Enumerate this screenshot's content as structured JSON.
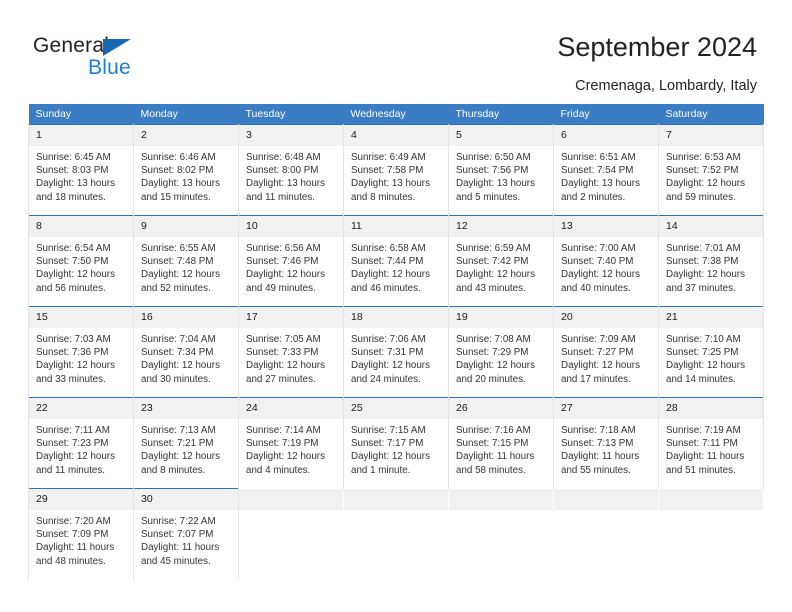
{
  "brand": {
    "name_part1": "General",
    "name_part2": "Blue",
    "triangle_color": "#1668b3",
    "blue_text_color": "#1b7fd4"
  },
  "header": {
    "title": "September 2024",
    "subtitle": "Cremenaga, Lombardy, Italy"
  },
  "theme": {
    "header_bg": "#3b7dc4",
    "row_divider": "#2f6fb5",
    "daynum_bg": "#f1f1f1",
    "cell_border": "#e3e3e3"
  },
  "weekdays": [
    "Sunday",
    "Monday",
    "Tuesday",
    "Wednesday",
    "Thursday",
    "Friday",
    "Saturday"
  ],
  "labels": {
    "sunrise": "Sunrise:",
    "sunset": "Sunset:",
    "daylight": "Daylight:"
  },
  "weeks": [
    [
      {
        "day": "1",
        "sunrise": "Sunrise: 6:45 AM",
        "sunset": "Sunset: 8:03 PM",
        "daylight_line1": "Daylight: 13 hours",
        "daylight_line2": "and 18 minutes."
      },
      {
        "day": "2",
        "sunrise": "Sunrise: 6:46 AM",
        "sunset": "Sunset: 8:02 PM",
        "daylight_line1": "Daylight: 13 hours",
        "daylight_line2": "and 15 minutes."
      },
      {
        "day": "3",
        "sunrise": "Sunrise: 6:48 AM",
        "sunset": "Sunset: 8:00 PM",
        "daylight_line1": "Daylight: 13 hours",
        "daylight_line2": "and 11 minutes."
      },
      {
        "day": "4",
        "sunrise": "Sunrise: 6:49 AM",
        "sunset": "Sunset: 7:58 PM",
        "daylight_line1": "Daylight: 13 hours",
        "daylight_line2": "and 8 minutes."
      },
      {
        "day": "5",
        "sunrise": "Sunrise: 6:50 AM",
        "sunset": "Sunset: 7:56 PM",
        "daylight_line1": "Daylight: 13 hours",
        "daylight_line2": "and 5 minutes."
      },
      {
        "day": "6",
        "sunrise": "Sunrise: 6:51 AM",
        "sunset": "Sunset: 7:54 PM",
        "daylight_line1": "Daylight: 13 hours",
        "daylight_line2": "and 2 minutes."
      },
      {
        "day": "7",
        "sunrise": "Sunrise: 6:53 AM",
        "sunset": "Sunset: 7:52 PM",
        "daylight_line1": "Daylight: 12 hours",
        "daylight_line2": "and 59 minutes."
      }
    ],
    [
      {
        "day": "8",
        "sunrise": "Sunrise: 6:54 AM",
        "sunset": "Sunset: 7:50 PM",
        "daylight_line1": "Daylight: 12 hours",
        "daylight_line2": "and 56 minutes."
      },
      {
        "day": "9",
        "sunrise": "Sunrise: 6:55 AM",
        "sunset": "Sunset: 7:48 PM",
        "daylight_line1": "Daylight: 12 hours",
        "daylight_line2": "and 52 minutes."
      },
      {
        "day": "10",
        "sunrise": "Sunrise: 6:56 AM",
        "sunset": "Sunset: 7:46 PM",
        "daylight_line1": "Daylight: 12 hours",
        "daylight_line2": "and 49 minutes."
      },
      {
        "day": "11",
        "sunrise": "Sunrise: 6:58 AM",
        "sunset": "Sunset: 7:44 PM",
        "daylight_line1": "Daylight: 12 hours",
        "daylight_line2": "and 46 minutes."
      },
      {
        "day": "12",
        "sunrise": "Sunrise: 6:59 AM",
        "sunset": "Sunset: 7:42 PM",
        "daylight_line1": "Daylight: 12 hours",
        "daylight_line2": "and 43 minutes."
      },
      {
        "day": "13",
        "sunrise": "Sunrise: 7:00 AM",
        "sunset": "Sunset: 7:40 PM",
        "daylight_line1": "Daylight: 12 hours",
        "daylight_line2": "and 40 minutes."
      },
      {
        "day": "14",
        "sunrise": "Sunrise: 7:01 AM",
        "sunset": "Sunset: 7:38 PM",
        "daylight_line1": "Daylight: 12 hours",
        "daylight_line2": "and 37 minutes."
      }
    ],
    [
      {
        "day": "15",
        "sunrise": "Sunrise: 7:03 AM",
        "sunset": "Sunset: 7:36 PM",
        "daylight_line1": "Daylight: 12 hours",
        "daylight_line2": "and 33 minutes."
      },
      {
        "day": "16",
        "sunrise": "Sunrise: 7:04 AM",
        "sunset": "Sunset: 7:34 PM",
        "daylight_line1": "Daylight: 12 hours",
        "daylight_line2": "and 30 minutes."
      },
      {
        "day": "17",
        "sunrise": "Sunrise: 7:05 AM",
        "sunset": "Sunset: 7:33 PM",
        "daylight_line1": "Daylight: 12 hours",
        "daylight_line2": "and 27 minutes."
      },
      {
        "day": "18",
        "sunrise": "Sunrise: 7:06 AM",
        "sunset": "Sunset: 7:31 PM",
        "daylight_line1": "Daylight: 12 hours",
        "daylight_line2": "and 24 minutes."
      },
      {
        "day": "19",
        "sunrise": "Sunrise: 7:08 AM",
        "sunset": "Sunset: 7:29 PM",
        "daylight_line1": "Daylight: 12 hours",
        "daylight_line2": "and 20 minutes."
      },
      {
        "day": "20",
        "sunrise": "Sunrise: 7:09 AM",
        "sunset": "Sunset: 7:27 PM",
        "daylight_line1": "Daylight: 12 hours",
        "daylight_line2": "and 17 minutes."
      },
      {
        "day": "21",
        "sunrise": "Sunrise: 7:10 AM",
        "sunset": "Sunset: 7:25 PM",
        "daylight_line1": "Daylight: 12 hours",
        "daylight_line2": "and 14 minutes."
      }
    ],
    [
      {
        "day": "22",
        "sunrise": "Sunrise: 7:11 AM",
        "sunset": "Sunset: 7:23 PM",
        "daylight_line1": "Daylight: 12 hours",
        "daylight_line2": "and 11 minutes."
      },
      {
        "day": "23",
        "sunrise": "Sunrise: 7:13 AM",
        "sunset": "Sunset: 7:21 PM",
        "daylight_line1": "Daylight: 12 hours",
        "daylight_line2": "and 8 minutes."
      },
      {
        "day": "24",
        "sunrise": "Sunrise: 7:14 AM",
        "sunset": "Sunset: 7:19 PM",
        "daylight_line1": "Daylight: 12 hours",
        "daylight_line2": "and 4 minutes."
      },
      {
        "day": "25",
        "sunrise": "Sunrise: 7:15 AM",
        "sunset": "Sunset: 7:17 PM",
        "daylight_line1": "Daylight: 12 hours",
        "daylight_line2": "and 1 minute."
      },
      {
        "day": "26",
        "sunrise": "Sunrise: 7:16 AM",
        "sunset": "Sunset: 7:15 PM",
        "daylight_line1": "Daylight: 11 hours",
        "daylight_line2": "and 58 minutes."
      },
      {
        "day": "27",
        "sunrise": "Sunrise: 7:18 AM",
        "sunset": "Sunset: 7:13 PM",
        "daylight_line1": "Daylight: 11 hours",
        "daylight_line2": "and 55 minutes."
      },
      {
        "day": "28",
        "sunrise": "Sunrise: 7:19 AM",
        "sunset": "Sunset: 7:11 PM",
        "daylight_line1": "Daylight: 11 hours",
        "daylight_line2": "and 51 minutes."
      }
    ],
    [
      {
        "day": "29",
        "sunrise": "Sunrise: 7:20 AM",
        "sunset": "Sunset: 7:09 PM",
        "daylight_line1": "Daylight: 11 hours",
        "daylight_line2": "and 48 minutes."
      },
      {
        "day": "30",
        "sunrise": "Sunrise: 7:22 AM",
        "sunset": "Sunset: 7:07 PM",
        "daylight_line1": "Daylight: 11 hours",
        "daylight_line2": "and 45 minutes."
      },
      {
        "day": "",
        "sunrise": "",
        "sunset": "",
        "daylight_line1": "",
        "daylight_line2": ""
      },
      {
        "day": "",
        "sunrise": "",
        "sunset": "",
        "daylight_line1": "",
        "daylight_line2": ""
      },
      {
        "day": "",
        "sunrise": "",
        "sunset": "",
        "daylight_line1": "",
        "daylight_line2": ""
      },
      {
        "day": "",
        "sunrise": "",
        "sunset": "",
        "daylight_line1": "",
        "daylight_line2": ""
      },
      {
        "day": "",
        "sunrise": "",
        "sunset": "",
        "daylight_line1": "",
        "daylight_line2": ""
      }
    ]
  ]
}
